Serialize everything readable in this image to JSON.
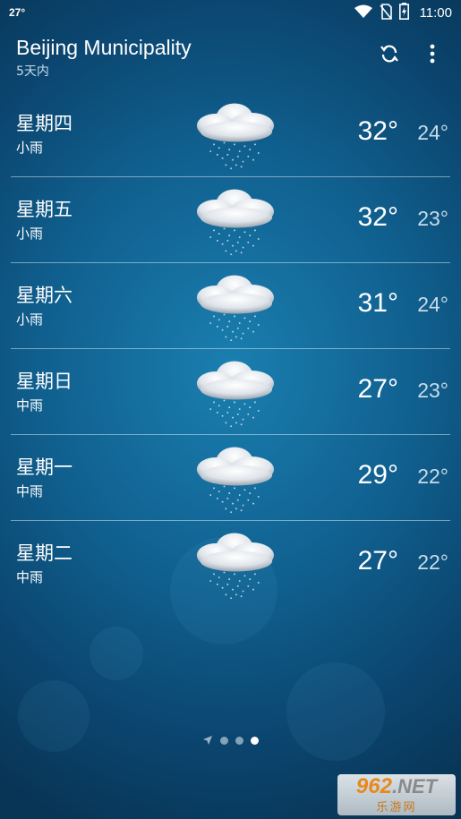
{
  "status_bar": {
    "temperature": "27°",
    "time": "11:00",
    "icons": [
      "wifi-icon",
      "no-sim-icon",
      "battery-charging-icon"
    ]
  },
  "header": {
    "city": "Beijing Municipality",
    "subtitle": "5天内",
    "actions": [
      "refresh-icon",
      "more-vert-icon"
    ]
  },
  "forecast": [
    {
      "day": "星期四",
      "condition": "小雨",
      "high": "32°",
      "low": "24°",
      "icon": "light-rain-icon"
    },
    {
      "day": "星期五",
      "condition": "小雨",
      "high": "32°",
      "low": "23°",
      "icon": "light-rain-icon"
    },
    {
      "day": "星期六",
      "condition": "小雨",
      "high": "31°",
      "low": "24°",
      "icon": "light-rain-icon"
    },
    {
      "day": "星期日",
      "condition": "中雨",
      "high": "27°",
      "low": "23°",
      "icon": "moderate-rain-icon"
    },
    {
      "day": "星期一",
      "condition": "中雨",
      "high": "29°",
      "low": "22°",
      "icon": "moderate-rain-icon"
    },
    {
      "day": "星期二",
      "condition": "中雨",
      "high": "27°",
      "low": "22°",
      "icon": "moderate-rain-icon"
    }
  ],
  "pager": {
    "count": 4,
    "active_index": 3,
    "first_icon": "location-arrow-icon"
  },
  "watermark": {
    "brand": "962",
    "tld": ".NET",
    "tagline": "乐游网"
  },
  "colors": {
    "background": "#10608f",
    "text": "#ffffff",
    "low_temp": "#c9dbe8",
    "watermark_orange": "#e8891c"
  }
}
